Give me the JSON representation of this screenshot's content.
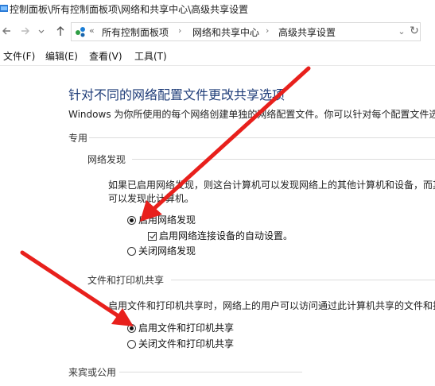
{
  "window": {
    "title": "控制面板\\所有控制面板项\\网络和共享中心\\高级共享设置"
  },
  "address_bar": {
    "prefix": "«",
    "crumbs": [
      "所有控制面板项",
      "网络和共享中心",
      "高级共享设置"
    ],
    "separator": "›"
  },
  "menu": {
    "items": [
      "文件(F)",
      "编辑(E)",
      "查看(V)",
      "工具(T)"
    ]
  },
  "content": {
    "title": "针对不同的网络配置文件更改共享选项",
    "intro": "Windows 为你所使用的每个网络创建单独的网络配置文件。你可以针对每个配置文件选",
    "profile_private": {
      "heading": "专用",
      "network_discovery": {
        "heading": "网络发现",
        "desc_line1": "如果已启用网络发现，则这台计算机可以发现网络上的其他计算机和设备，而其",
        "desc_line2": "可以发现此计算机。",
        "option_on": "启用网络发现",
        "auto_setup": "启用网络连接设备的自动设置。",
        "option_off": "关闭网络发现",
        "selected": "on",
        "auto_setup_checked": true
      },
      "file_printer_sharing": {
        "heading": "文件和打印机共享",
        "desc": "启用文件和打印机共享时，网络上的用户可以访问通过此计算机共享的文件和打",
        "option_on": "启用文件和打印机共享",
        "option_off": "关闭文件和打印机共享",
        "selected": "on"
      }
    },
    "profile_guest_public": {
      "heading": "来宾或公用"
    }
  },
  "colors": {
    "title_blue": "#1e3c78",
    "annotation_arrow": "#e8201c"
  },
  "icons": {
    "back": "back-arrow-icon",
    "forward": "forward-arrow-icon",
    "up": "up-arrow-icon",
    "address": "control-panel-icon",
    "refresh": "refresh-icon",
    "dropdown": "chevron-down-icon"
  }
}
